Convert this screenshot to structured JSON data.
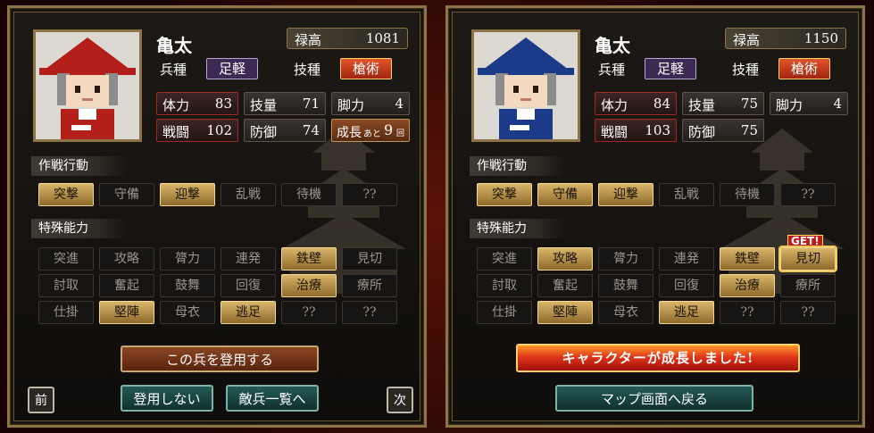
{
  "left": {
    "name": "亀太",
    "stipend_label": "禄高",
    "stipend_value": "1081",
    "unit_label": "兵種",
    "unit_value": "足軽",
    "skill_label": "技種",
    "skill_value": "槍術",
    "stats": {
      "hp_label": "体力",
      "hp": "83",
      "tech_label": "技量",
      "tech": "71",
      "leg_label": "脚力",
      "leg": "4",
      "atk_label": "戦闘",
      "atk": "102",
      "def_label": "防御",
      "def": "74"
    },
    "growth": {
      "label": "成長",
      "prefix": "あと",
      "count": "9",
      "suffix": "回"
    },
    "tactics_header": "作戦行動",
    "tactics": [
      {
        "label": "突撃",
        "active": true
      },
      {
        "label": "守備",
        "active": false
      },
      {
        "label": "迎撃",
        "active": true
      },
      {
        "label": "乱戦",
        "active": false
      },
      {
        "label": "待機",
        "active": false
      },
      {
        "label": "??",
        "active": false
      }
    ],
    "abilities_header": "特殊能力",
    "abilities": [
      {
        "label": "突進",
        "active": false
      },
      {
        "label": "攻略",
        "active": false
      },
      {
        "label": "膂力",
        "active": false
      },
      {
        "label": "連発",
        "active": false
      },
      {
        "label": "鉄壁",
        "active": true
      },
      {
        "label": "見切",
        "active": false
      },
      {
        "label": "討取",
        "active": false
      },
      {
        "label": "奮起",
        "active": false
      },
      {
        "label": "鼓舞",
        "active": false
      },
      {
        "label": "回復",
        "active": false
      },
      {
        "label": "治療",
        "active": true
      },
      {
        "label": "療所",
        "active": false
      },
      {
        "label": "仕掛",
        "active": false
      },
      {
        "label": "堅陣",
        "active": true
      },
      {
        "label": "母衣",
        "active": false
      },
      {
        "label": "逃足",
        "active": true
      },
      {
        "label": "??",
        "active": false
      },
      {
        "label": "??",
        "active": false
      }
    ],
    "recruit_button": "この兵を登用する",
    "prev_button": "前",
    "no_recruit_button": "登用しない",
    "enemy_list_button": "敵兵一覧へ",
    "next_button": "次",
    "hat_color": "#b3201a"
  },
  "right": {
    "name": "亀太",
    "stipend_label": "禄高",
    "stipend_value": "1150",
    "unit_label": "兵種",
    "unit_value": "足軽",
    "skill_label": "技種",
    "skill_value": "槍術",
    "stats": {
      "hp_label": "体力",
      "hp": "84",
      "tech_label": "技量",
      "tech": "75",
      "leg_label": "脚力",
      "leg": "4",
      "atk_label": "戦闘",
      "atk": "103",
      "def_label": "防御",
      "def": "75"
    },
    "tactics_header": "作戦行動",
    "tactics": [
      {
        "label": "突撃",
        "active": true
      },
      {
        "label": "守備",
        "active": true
      },
      {
        "label": "迎撃",
        "active": true
      },
      {
        "label": "乱戦",
        "active": false
      },
      {
        "label": "待機",
        "active": false
      },
      {
        "label": "??",
        "active": false
      }
    ],
    "abilities_header": "特殊能力",
    "abilities": [
      {
        "label": "突進",
        "active": false
      },
      {
        "label": "攻略",
        "active": true
      },
      {
        "label": "膂力",
        "active": false
      },
      {
        "label": "連発",
        "active": false
      },
      {
        "label": "鉄壁",
        "active": true
      },
      {
        "label": "見切",
        "active": true
      },
      {
        "label": "討取",
        "active": false
      },
      {
        "label": "奮起",
        "active": false
      },
      {
        "label": "鼓舞",
        "active": false
      },
      {
        "label": "回復",
        "active": false
      },
      {
        "label": "治療",
        "active": true
      },
      {
        "label": "療所",
        "active": false
      },
      {
        "label": "仕掛",
        "active": false
      },
      {
        "label": "堅陣",
        "active": true
      },
      {
        "label": "母衣",
        "active": false
      },
      {
        "label": "逃足",
        "active": true
      },
      {
        "label": "??",
        "active": false
      },
      {
        "label": "??",
        "active": false
      }
    ],
    "get_badge": "GET!",
    "growth_banner": "キャラクターが成長しました!",
    "map_button": "マップ画面へ戻る",
    "hat_color": "#1b3a8a"
  }
}
